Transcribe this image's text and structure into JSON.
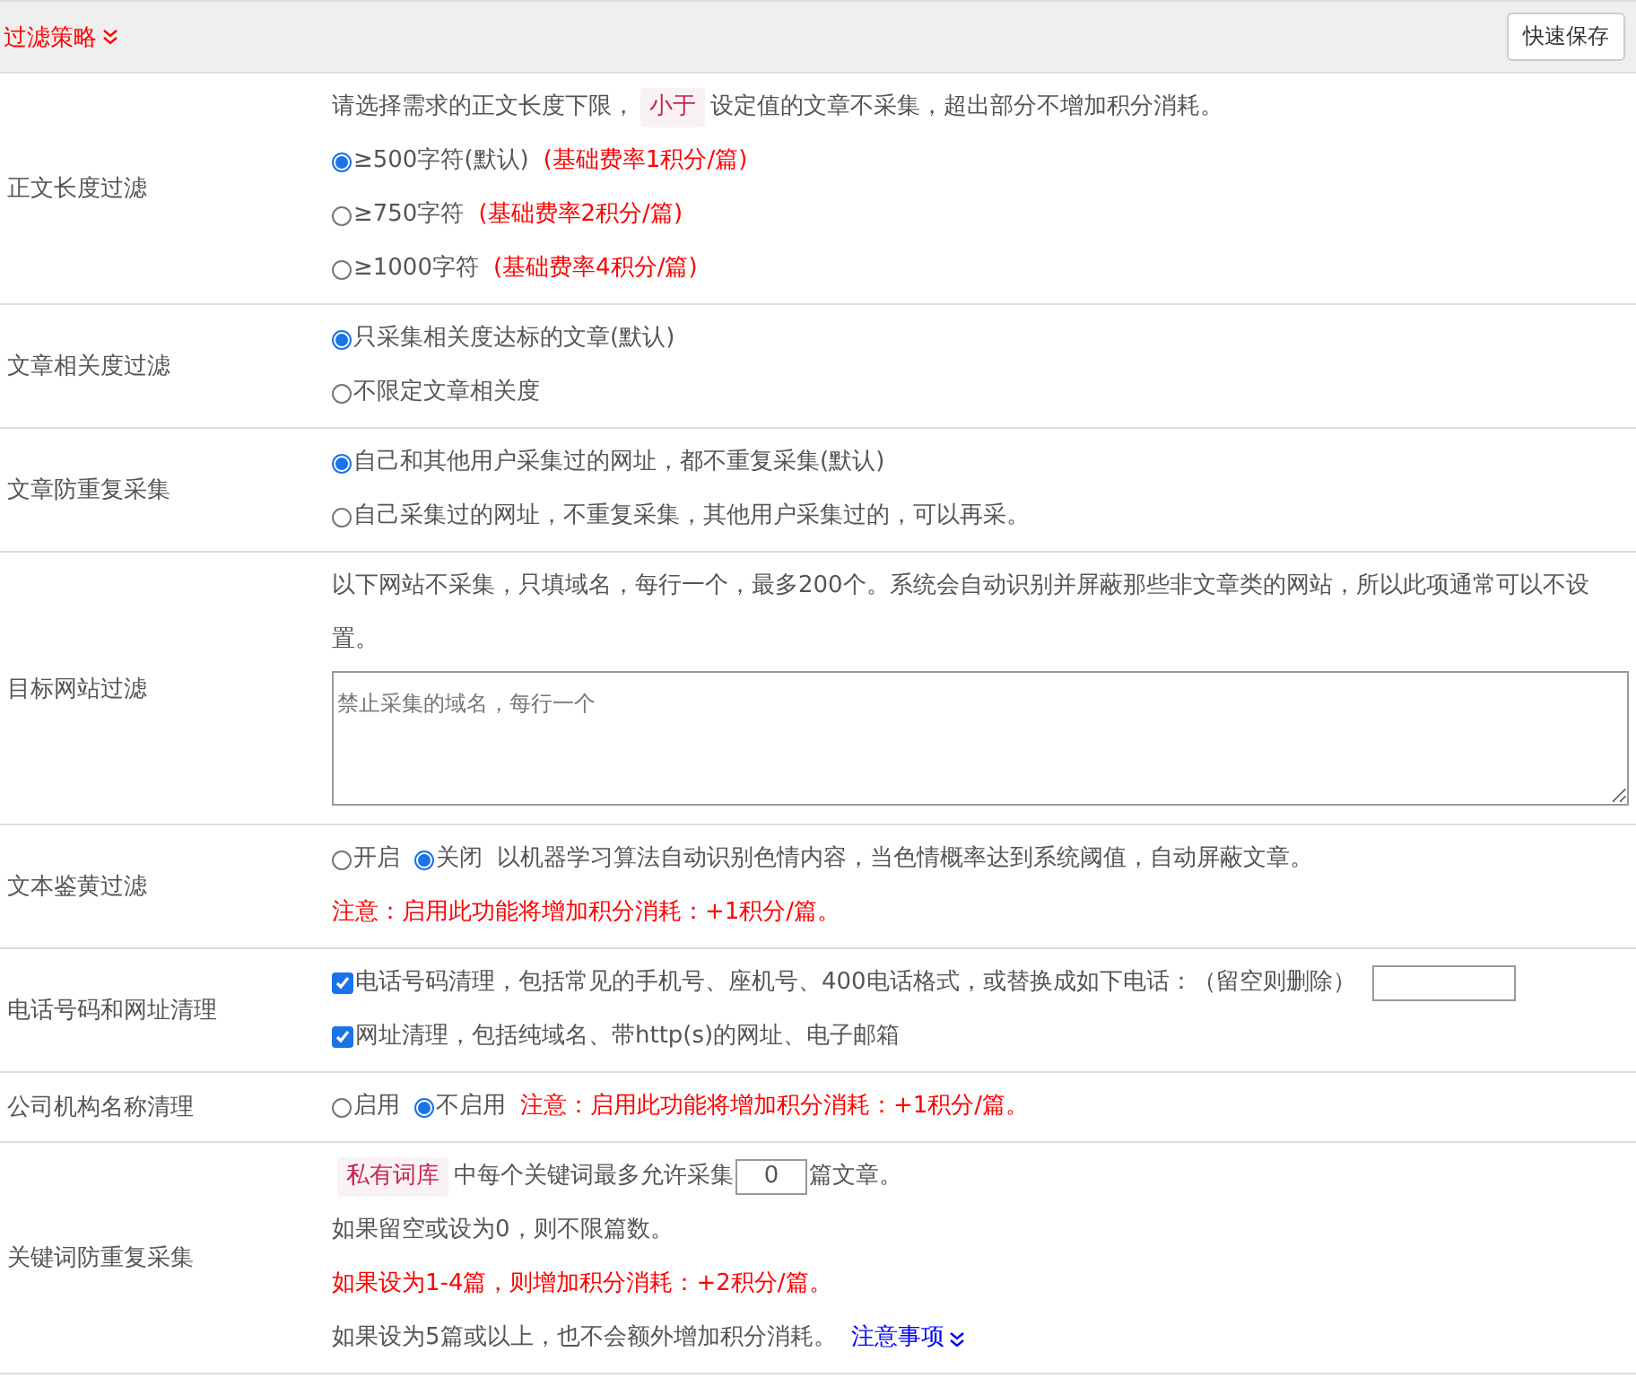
{
  "header": {
    "title": "过滤策略",
    "button": "快速保存"
  },
  "sections": [
    {
      "label": "正文长度过滤",
      "lines": [
        [
          {
            "kind": "text",
            "text": "请选择需求的正文长度下限，"
          },
          {
            "kind": "tag",
            "text": "小于"
          },
          {
            "kind": "text",
            "text": "设定值的文章不采集，超出部分不增加积分消耗。"
          }
        ],
        [
          {
            "kind": "radio",
            "label": "≥500字符(默认)",
            "selected": true
          },
          {
            "kind": "warn",
            "text": "(基础费率1积分/篇)"
          }
        ],
        [
          {
            "kind": "radio",
            "label": "≥750字符",
            "selected": false
          },
          {
            "kind": "warn",
            "text": "(基础费率2积分/篇)"
          }
        ],
        [
          {
            "kind": "radio",
            "label": "≥1000字符",
            "selected": false
          },
          {
            "kind": "warn",
            "text": "(基础费率4积分/篇)"
          }
        ]
      ]
    },
    {
      "label": "文章相关度过滤",
      "lines": [
        [
          {
            "kind": "radio",
            "label": "只采集相关度达标的文章(默认)",
            "selected": true
          }
        ],
        [
          {
            "kind": "radio",
            "label": "不限定文章相关度",
            "selected": false
          }
        ]
      ]
    },
    {
      "label": "文章防重复采集",
      "lines": [
        [
          {
            "kind": "radio",
            "label": "自己和其他用户采集过的网址，都不重复采集(默认)",
            "selected": true
          }
        ],
        [
          {
            "kind": "radio",
            "label": "自己采集过的网址，不重复采集，其他用户采集过的，可以再采。",
            "selected": false
          }
        ]
      ]
    },
    {
      "label": "目标网站过滤",
      "lines": [
        [
          {
            "kind": "text",
            "text": "以下网站不采集，只填域名，每行一个，最多200个。系统会自动识别并屏蔽那些非文章类的网站，所以此项通常可以不设置。"
          }
        ],
        [
          {
            "kind": "textarea",
            "placeholder": "禁止采集的域名，每行一个"
          }
        ]
      ]
    },
    {
      "label": "文本鉴黄过滤",
      "lines": [
        [
          {
            "kind": "radio",
            "label": "开启",
            "selected": false
          },
          {
            "kind": "radio",
            "label": "关闭",
            "selected": true
          },
          {
            "kind": "text",
            "text": "以机器学习算法自动识别色情内容，当色情概率达到系统阈值，自动屏蔽文章。"
          }
        ],
        [
          {
            "kind": "warn",
            "text": "注意：启用此功能将增加积分消耗：+1积分/篇。"
          }
        ]
      ]
    },
    {
      "label": "电话号码和网址清理",
      "lines": [
        [
          {
            "kind": "checkbox",
            "label": "电话号码清理，包括常见的手机号、座机号、400电话格式，或替换成如下电话：（留空则删除）",
            "checked": true
          },
          {
            "kind": "input"
          }
        ],
        [
          {
            "kind": "checkbox",
            "label": "网址清理，包括纯域名、带http(s)的网址、电子邮箱",
            "checked": true
          }
        ]
      ]
    },
    {
      "label": "公司机构名称清理",
      "lines": [
        [
          {
            "kind": "radio",
            "label": "启用",
            "selected": false
          },
          {
            "kind": "radio",
            "label": "不启用",
            "selected": true
          },
          {
            "kind": "warn",
            "text": "注意：启用此功能将增加积分消耗：+1积分/篇。"
          }
        ]
      ]
    },
    {
      "label": "关键词防重复采集",
      "lines": [
        [
          {
            "kind": "tag",
            "text": "私有词库"
          },
          {
            "kind": "text",
            "text": "中每个关键词最多允许采集"
          },
          {
            "kind": "input",
            "value": "0"
          },
          {
            "kind": "text",
            "text": "篇文章。"
          }
        ],
        [
          {
            "kind": "text",
            "text": "如果留空或设为0，则不限篇数。"
          }
        ],
        [
          {
            "kind": "warn",
            "text": "如果设为1-4篇，则增加积分消耗：+2积分/篇。"
          }
        ],
        [
          {
            "kind": "text",
            "text": "如果设为5篇或以上，也不会额外增加积分消耗。"
          },
          {
            "kind": "link",
            "text": "注意事项"
          }
        ]
      ]
    }
  ]
}
